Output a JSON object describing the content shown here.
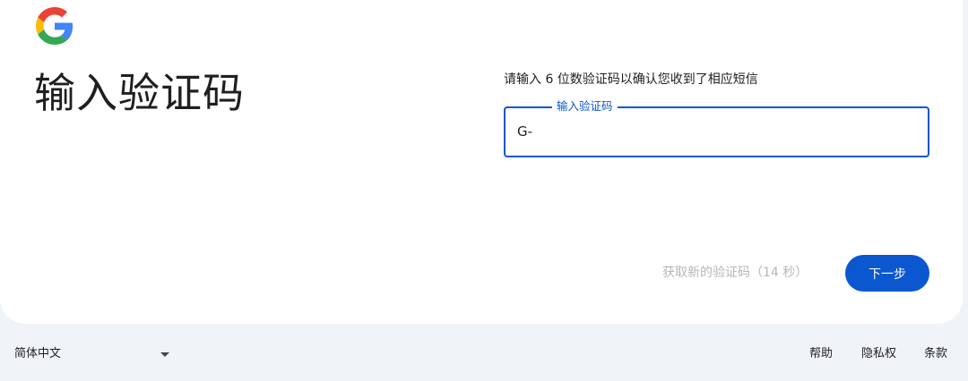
{
  "brand": {
    "logo_icon": "google-g-logo",
    "colors": {
      "blue": "#4285F4",
      "red": "#EA4335",
      "yellow": "#FBBC05",
      "green": "#34A853",
      "accent": "#0b57d0"
    }
  },
  "page": {
    "title": "输入验证码",
    "instruction": "请输入 6 位数验证码以确认您收到了相应短信"
  },
  "code_field": {
    "label": "输入验证码",
    "value": "G-"
  },
  "actions": {
    "resend_label": "获取新的验证码（14 秒）",
    "next_label": "下一步"
  },
  "footer": {
    "language": "简体中文",
    "links": {
      "help": "帮助",
      "privacy": "隐私权",
      "terms": "条款"
    }
  }
}
